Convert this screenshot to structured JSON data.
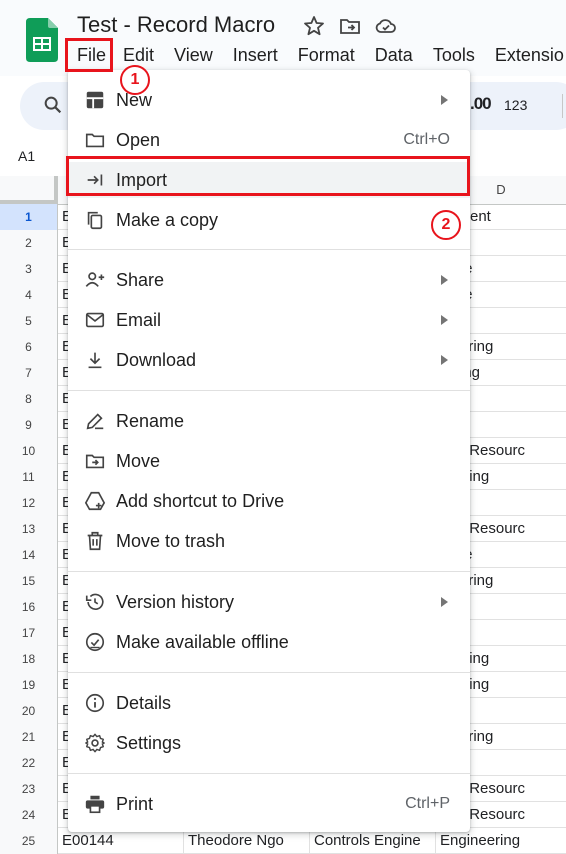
{
  "app": {
    "title": "Test - Record Macro",
    "menus": [
      "File",
      "Edit",
      "View",
      "Insert",
      "Format",
      "Data",
      "Tools",
      "Extensio"
    ]
  },
  "toolbar": {
    "format_decimal": ".00",
    "number_format": "123"
  },
  "name_box": "A1",
  "grid": {
    "column_headers": [
      "D"
    ],
    "rows": [
      {
        "num": "1",
        "a": "E",
        "d": "artment"
      },
      {
        "num": "2",
        "a": "E",
        "d": "es"
      },
      {
        "num": "3",
        "a": "E",
        "d": "ance"
      },
      {
        "num": "4",
        "a": "E",
        "d": "ance"
      },
      {
        "num": "5",
        "a": "E",
        "d": "es"
      },
      {
        "num": "6",
        "a": "E",
        "d": "ineering"
      },
      {
        "num": "7",
        "a": "E",
        "d": "keting"
      },
      {
        "num": "8",
        "a": "E",
        "d": ""
      },
      {
        "num": "9",
        "a": "E",
        "d": ""
      },
      {
        "num": "10",
        "a": "E",
        "d": "nan Resourc"
      },
      {
        "num": "11",
        "a": "E",
        "d": "ounting"
      },
      {
        "num": "12",
        "a": "E",
        "d": ""
      },
      {
        "num": "13",
        "a": "E",
        "d": "nan Resourc"
      },
      {
        "num": "14",
        "a": "E",
        "d": "ance"
      },
      {
        "num": "15",
        "a": "E",
        "d": "ineering"
      },
      {
        "num": "16",
        "a": "E",
        "d": ""
      },
      {
        "num": "17",
        "a": "E",
        "d": ""
      },
      {
        "num": "18",
        "a": "E",
        "d": "ounting"
      },
      {
        "num": "19",
        "a": "E",
        "d": "ounting"
      },
      {
        "num": "20",
        "a": "E",
        "d": "es"
      },
      {
        "num": "21",
        "a": "E",
        "d": "ineering"
      },
      {
        "num": "22",
        "a": "E",
        "d": ""
      },
      {
        "num": "23",
        "a": "E",
        "d": "nan Resourc"
      },
      {
        "num": "24",
        "a": "E",
        "d": "nan Resourc"
      },
      {
        "num": "25",
        "a": "E00144",
        "b": "Theodore Ngo",
        "c": "Controls Engine",
        "d": "Engineering"
      }
    ]
  },
  "file_menu": {
    "items": [
      {
        "label": "New",
        "icon": "new-sheet-icon",
        "submenu": true
      },
      {
        "label": "Open",
        "icon": "folder-icon",
        "shortcut": "Ctrl+O"
      },
      {
        "label": "Import",
        "icon": "import-icon"
      },
      {
        "label": "Make a copy",
        "icon": "copy-icon"
      },
      {
        "label": "Share",
        "icon": "share-person-icon",
        "submenu": true
      },
      {
        "label": "Email",
        "icon": "email-icon",
        "submenu": true
      },
      {
        "label": "Download",
        "icon": "download-icon",
        "submenu": true
      },
      {
        "label": "Rename",
        "icon": "rename-icon"
      },
      {
        "label": "Move",
        "icon": "move-folder-icon"
      },
      {
        "label": "Add shortcut to Drive",
        "icon": "drive-shortcut-icon"
      },
      {
        "label": "Move to trash",
        "icon": "trash-icon"
      },
      {
        "label": "Version history",
        "icon": "history-icon",
        "submenu": true
      },
      {
        "label": "Make available offline",
        "icon": "offline-icon"
      },
      {
        "label": "Details",
        "icon": "info-icon"
      },
      {
        "label": "Settings",
        "icon": "gear-icon"
      },
      {
        "label": "Print",
        "icon": "print-icon",
        "shortcut": "Ctrl+P"
      }
    ]
  },
  "annotations": {
    "step1": "1",
    "step2": "2"
  },
  "colors": {
    "highlight": "#e8141c",
    "sheets_green": "#0f9d58"
  }
}
